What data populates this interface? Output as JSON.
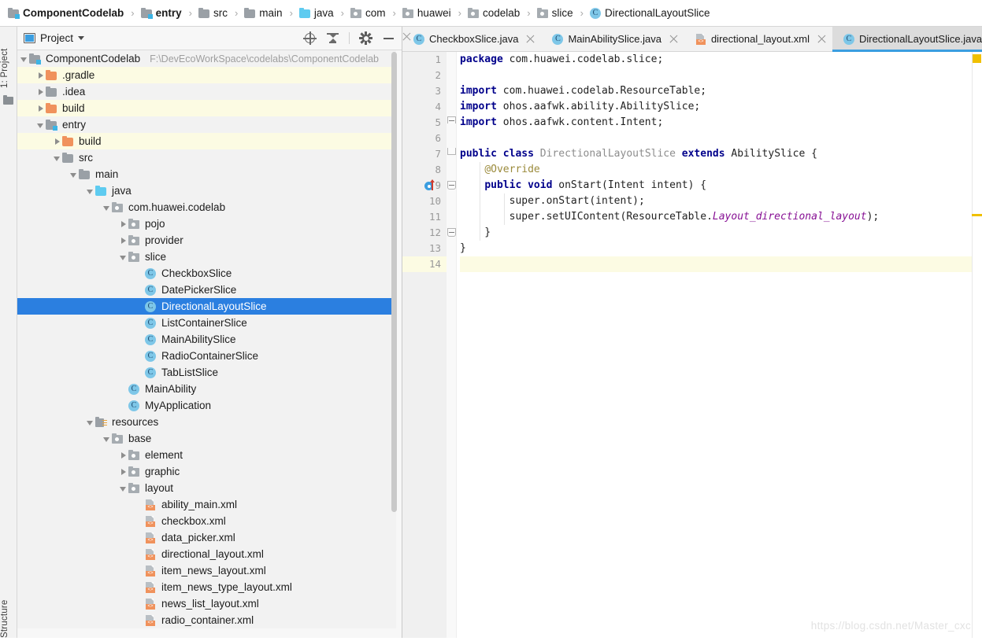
{
  "breadcrumb": {
    "separator": "›",
    "items": [
      {
        "label": "ComponentCodelab",
        "icon": "module-icon",
        "bold": true
      },
      {
        "label": "entry",
        "icon": "module-icon",
        "bold": true
      },
      {
        "label": "src",
        "icon": "folder-icon",
        "bold": false
      },
      {
        "label": "main",
        "icon": "folder-icon",
        "bold": false
      },
      {
        "label": "java",
        "icon": "source-folder-icon",
        "bold": false
      },
      {
        "label": "com",
        "icon": "package-icon",
        "bold": false
      },
      {
        "label": "huawei",
        "icon": "package-icon",
        "bold": false
      },
      {
        "label": "codelab",
        "icon": "package-icon",
        "bold": false
      },
      {
        "label": "slice",
        "icon": "package-icon",
        "bold": false
      },
      {
        "label": "DirectionalLayoutSlice",
        "icon": "class-icon",
        "bold": false
      }
    ]
  },
  "left_rail": {
    "project_tab": "1: Project",
    "structure_tab": "Structure"
  },
  "project_panel": {
    "title": "Project",
    "view_icon": "project-view-icon",
    "dropdown_icon": "chevron-down-icon",
    "tools": [
      {
        "name": "locate-icon",
        "title": "Select Opened File"
      },
      {
        "name": "collapse-all-icon",
        "title": "Collapse All"
      },
      {
        "name": "gear-icon",
        "title": "Settings"
      },
      {
        "name": "minimize-icon",
        "title": "Hide"
      }
    ],
    "close_icon": "close-icon"
  },
  "tree": [
    {
      "label": "ComponentCodelab",
      "path": "F:\\DevEcoWorkSpace\\codelabs\\ComponentCodelab",
      "indent": 0,
      "arrow": "open",
      "icon": "module-icon",
      "bg": "white"
    },
    {
      "label": ".gradle",
      "path": "",
      "indent": 1,
      "arrow": "closed",
      "icon": "folder-orange-icon",
      "bg": "yellow"
    },
    {
      "label": ".idea",
      "path": "",
      "indent": 1,
      "arrow": "closed",
      "icon": "folder-icon",
      "bg": "white"
    },
    {
      "label": "build",
      "path": "",
      "indent": 1,
      "arrow": "closed",
      "icon": "folder-orange-icon",
      "bg": "yellow"
    },
    {
      "label": "entry",
      "path": "",
      "indent": 1,
      "arrow": "open",
      "icon": "module-icon",
      "bg": "white"
    },
    {
      "label": "build",
      "path": "",
      "indent": 2,
      "arrow": "closed",
      "icon": "folder-orange-icon",
      "bg": "yellow"
    },
    {
      "label": "src",
      "path": "",
      "indent": 2,
      "arrow": "open",
      "icon": "folder-icon",
      "bg": "white"
    },
    {
      "label": "main",
      "path": "",
      "indent": 3,
      "arrow": "open",
      "icon": "folder-icon",
      "bg": "white"
    },
    {
      "label": "java",
      "path": "",
      "indent": 4,
      "arrow": "open",
      "icon": "source-folder-icon",
      "bg": "white"
    },
    {
      "label": "com.huawei.codelab",
      "path": "",
      "indent": 5,
      "arrow": "open",
      "icon": "package-icon",
      "bg": "white"
    },
    {
      "label": "pojo",
      "path": "",
      "indent": 6,
      "arrow": "closed",
      "icon": "package-icon",
      "bg": "white"
    },
    {
      "label": "provider",
      "path": "",
      "indent": 6,
      "arrow": "closed",
      "icon": "package-icon",
      "bg": "white"
    },
    {
      "label": "slice",
      "path": "",
      "indent": 6,
      "arrow": "open",
      "icon": "package-icon",
      "bg": "white"
    },
    {
      "label": "CheckboxSlice",
      "path": "",
      "indent": 7,
      "arrow": "none",
      "icon": "class-icon",
      "bg": "white"
    },
    {
      "label": "DatePickerSlice",
      "path": "",
      "indent": 7,
      "arrow": "none",
      "icon": "class-icon",
      "bg": "white"
    },
    {
      "label": "DirectionalLayoutSlice",
      "path": "",
      "indent": 7,
      "arrow": "none",
      "icon": "class-icon",
      "bg": "selected"
    },
    {
      "label": "ListContainerSlice",
      "path": "",
      "indent": 7,
      "arrow": "none",
      "icon": "class-icon",
      "bg": "white"
    },
    {
      "label": "MainAbilitySlice",
      "path": "",
      "indent": 7,
      "arrow": "none",
      "icon": "class-icon",
      "bg": "white"
    },
    {
      "label": "RadioContainerSlice",
      "path": "",
      "indent": 7,
      "arrow": "none",
      "icon": "class-icon",
      "bg": "white"
    },
    {
      "label": "TabListSlice",
      "path": "",
      "indent": 7,
      "arrow": "none",
      "icon": "class-icon",
      "bg": "white"
    },
    {
      "label": "MainAbility",
      "path": "",
      "indent": 6,
      "arrow": "none",
      "icon": "class-icon",
      "bg": "white"
    },
    {
      "label": "MyApplication",
      "path": "",
      "indent": 6,
      "arrow": "none",
      "icon": "class-icon",
      "bg": "white"
    },
    {
      "label": "resources",
      "path": "",
      "indent": 4,
      "arrow": "open",
      "icon": "resources-folder-icon",
      "bg": "white"
    },
    {
      "label": "base",
      "path": "",
      "indent": 5,
      "arrow": "open",
      "icon": "package-icon",
      "bg": "white"
    },
    {
      "label": "element",
      "path": "",
      "indent": 6,
      "arrow": "closed",
      "icon": "package-icon",
      "bg": "white"
    },
    {
      "label": "graphic",
      "path": "",
      "indent": 6,
      "arrow": "closed",
      "icon": "package-icon",
      "bg": "white"
    },
    {
      "label": "layout",
      "path": "",
      "indent": 6,
      "arrow": "open",
      "icon": "package-icon",
      "bg": "white"
    },
    {
      "label": "ability_main.xml",
      "path": "",
      "indent": 7,
      "arrow": "none",
      "icon": "xml-icon",
      "bg": "white"
    },
    {
      "label": "checkbox.xml",
      "path": "",
      "indent": 7,
      "arrow": "none",
      "icon": "xml-icon",
      "bg": "white"
    },
    {
      "label": "data_picker.xml",
      "path": "",
      "indent": 7,
      "arrow": "none",
      "icon": "xml-icon",
      "bg": "white"
    },
    {
      "label": "directional_layout.xml",
      "path": "",
      "indent": 7,
      "arrow": "none",
      "icon": "xml-icon",
      "bg": "white"
    },
    {
      "label": "item_news_layout.xml",
      "path": "",
      "indent": 7,
      "arrow": "none",
      "icon": "xml-icon",
      "bg": "white"
    },
    {
      "label": "item_news_type_layout.xml",
      "path": "",
      "indent": 7,
      "arrow": "none",
      "icon": "xml-icon",
      "bg": "white"
    },
    {
      "label": "news_list_layout.xml",
      "path": "",
      "indent": 7,
      "arrow": "none",
      "icon": "xml-icon",
      "bg": "white"
    },
    {
      "label": "radio_container.xml",
      "path": "",
      "indent": 7,
      "arrow": "none",
      "icon": "xml-icon",
      "bg": "white"
    }
  ],
  "editor": {
    "tabs": [
      {
        "label": "CheckboxSlice.java",
        "icon": "class-icon",
        "active": false,
        "closable": true
      },
      {
        "label": "MainAbilitySlice.java",
        "icon": "class-icon",
        "active": false,
        "closable": true
      },
      {
        "label": "directional_layout.xml",
        "icon": "xml-icon",
        "active": false,
        "closable": true
      },
      {
        "label": "DirectionalLayoutSlice.java",
        "icon": "class-icon",
        "active": true,
        "closable": false
      }
    ],
    "tab_overflow_count": "3",
    "line_numbers": [
      "1",
      "2",
      "3",
      "4",
      "5",
      "6",
      "7",
      "8",
      "9",
      "10",
      "11",
      "12",
      "13",
      "14"
    ],
    "highlighted_line": 14,
    "gutter_marker_line": 9,
    "code_lines": [
      "package com.huawei.codelab.slice;",
      "",
      "import com.huawei.codelab.ResourceTable;",
      "import ohos.aafwk.ability.AbilitySlice;",
      "import ohos.aafwk.content.Intent;",
      "",
      "public class DirectionalLayoutSlice extends AbilitySlice {",
      "    @Override",
      "    public void onStart(Intent intent) {",
      "        super.onStart(intent);",
      "        super.setUIContent(ResourceTable.Layout_directional_layout);",
      "    }",
      "}",
      ""
    ]
  },
  "watermark": "https://blog.csdn.net/Master_cxc",
  "colors": {
    "selection_blue": "#2b7fe0",
    "tab_accent": "#3b9ee0",
    "warning_yellow": "#f0c000",
    "folder_orange": "#f0925c",
    "source_cyan": "#5ecbf0",
    "keyword_navy": "#00008b",
    "field_purple": "#871094",
    "annotation_olive": "#9b8b3c",
    "row_yellow": "#fcfbe3"
  }
}
